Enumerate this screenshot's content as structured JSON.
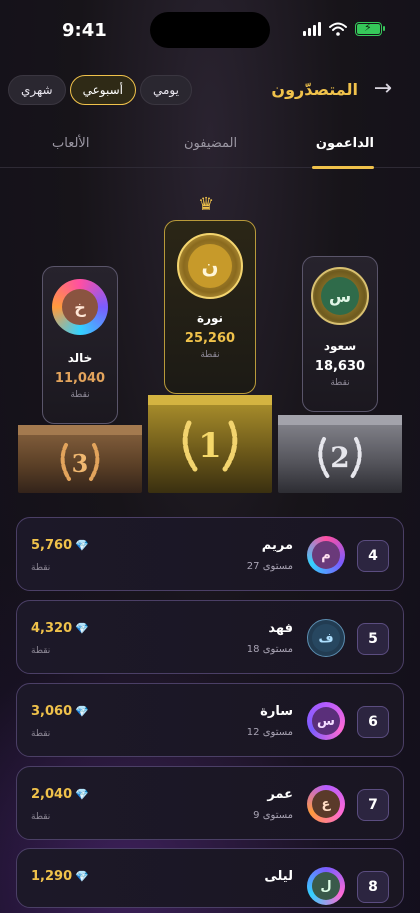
{
  "status": {
    "time": "9:41"
  },
  "header": {
    "title": "المتصدّرون",
    "back_icon": "arrow-right-icon",
    "periods": [
      {
        "label": "يومي",
        "active": false
      },
      {
        "label": "أسبوعي",
        "active": true
      },
      {
        "label": "شهري",
        "active": false
      }
    ]
  },
  "tabs": [
    {
      "label": "الداعمون",
      "active": true
    },
    {
      "label": "المضيفون",
      "active": false
    },
    {
      "label": "الألعاب",
      "active": false
    }
  ],
  "podium": {
    "unit": "نقطة",
    "first": {
      "rank": "1",
      "initial": "ن",
      "name": "نورة",
      "score": "25,260"
    },
    "second": {
      "rank": "2",
      "initial": "س",
      "name": "سعود",
      "score": "18,630"
    },
    "third": {
      "rank": "3",
      "initial": "خ",
      "name": "خالد",
      "score": "11,040"
    }
  },
  "list": {
    "unit": "نقطة",
    "rows": [
      {
        "rank": "4",
        "initial": "م",
        "name": "مريم",
        "level": "مستوى 27",
        "score": "5,760"
      },
      {
        "rank": "5",
        "initial": "ف",
        "name": "فهد",
        "level": "مستوى 18",
        "score": "4,320"
      },
      {
        "rank": "6",
        "initial": "س",
        "name": "سارة",
        "level": "مستوى 12",
        "score": "3,060"
      },
      {
        "rank": "7",
        "initial": "ع",
        "name": "عمر",
        "level": "مستوى 9",
        "score": "2,040"
      },
      {
        "rank": "8",
        "initial": "ل",
        "name": "ليلى",
        "level": "",
        "score": "1,290"
      }
    ]
  },
  "colors": {
    "accent": "#f0c24b",
    "gold": "#f0c24b",
    "silver": "#d6d6dc",
    "bronze": "#e3a45c"
  }
}
